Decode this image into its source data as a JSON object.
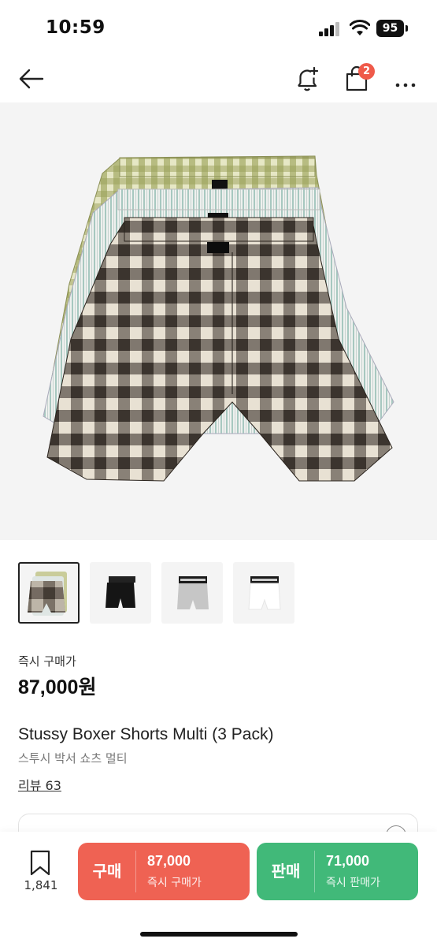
{
  "status_bar": {
    "time": "10:59",
    "battery": "95"
  },
  "nav": {
    "bag_badge": "2"
  },
  "price": {
    "label": "즉시 구매가",
    "value": "87,000원"
  },
  "product": {
    "name": "Stussy Boxer Shorts Multi (3 Pack)",
    "name_ko": "스투시 박서 쇼츠 멀티",
    "review": "리뷰 63"
  },
  "bottom": {
    "wish_count": "1,841",
    "buy": {
      "label": "구매",
      "price": "87,000",
      "sub": "즉시 구매가"
    },
    "sell": {
      "label": "판매",
      "price": "71,000",
      "sub": "즉시 판매가"
    }
  },
  "colors": {
    "buy": "#ef6253",
    "sell": "#41b979",
    "badge": "#ef5a4a"
  },
  "icons": [
    "back-arrow-icon",
    "bell-plus-icon",
    "shopping-bag-icon",
    "more-icon",
    "bookmark-icon",
    "wifi-icon",
    "signal-icon"
  ]
}
